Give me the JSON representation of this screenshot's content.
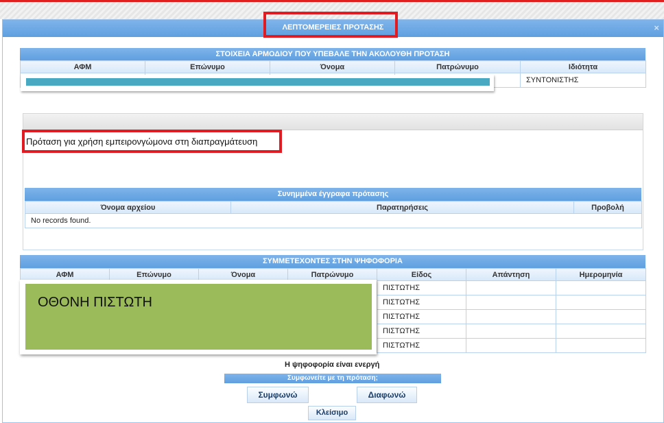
{
  "dialog": {
    "title": "ΛΕΠΤΟΜΕΡΕΙΕΣ ΠΡΟΤΑΣΗΣ",
    "close_glyph": "×"
  },
  "submitter": {
    "heading": "ΣΤΟΙΧΕΙΑ ΑΡΜΟΔΙΟΥ ΠΟΥ ΥΠΕΒΑΛΕ ΤΗΝ ΑΚΟΛΟΥΘΗ ΠΡΟΤΑΣΗ",
    "columns": [
      "ΑΦΜ",
      "Επώνυμο",
      "Όνομα",
      "Πατρώνυμο",
      "Ιδιότητα"
    ],
    "row": [
      "",
      "",
      "",
      "",
      "ΣΥΝΤΟΝΙΣΤΗΣ"
    ]
  },
  "proposal": {
    "text": "Πρόταση για χρήση εμπειρονγώμονα στη διαπραγμάτευση"
  },
  "attachments": {
    "heading": "Συνημμένα έγγραφα πρότασης",
    "columns": [
      "Όνομα αρχείου",
      "Παρατηρήσεις",
      "Προβολή"
    ],
    "empty_text": "No records found."
  },
  "voters": {
    "heading": "ΣΥΜΜΕΤΕΧΟΝΤΕΣ ΣΤΗΝ ΨΗΦΟΦΟΡΙΑ",
    "columns": [
      "ΑΦΜ",
      "Επώνυμο",
      "Όνομα",
      "Πατρώνυμο",
      "Είδος",
      "Απάντηση",
      "Ημερομηνία"
    ],
    "rows": [
      {
        "type": "ΠΙΣΤΩΤΗΣ"
      },
      {
        "type": "ΠΙΣΤΩΤΗΣ"
      },
      {
        "type": "ΠΙΣΤΩΤΗΣ"
      },
      {
        "type": "ΠΙΣΤΩΤΗΣ"
      },
      {
        "type": "ΠΙΣΤΩΤΗΣ"
      }
    ]
  },
  "overlay_label": "ΟΘΟΝΗ ΠΙΣΤΩΤΗ",
  "voting": {
    "status": "Η ψηφοφορία είναι ενεργή",
    "question": "Συμφωνείτε με τη πρόταση;",
    "agree_label": "Συμφωνώ",
    "disagree_label": "Διαφωνώ",
    "close_label": "Κλείσιμο"
  },
  "colors": {
    "header_blue": "#6aa8e6",
    "highlight_red": "#e11b22",
    "overlay_green": "#9bba59",
    "redaction_teal": "#4aa9c2"
  }
}
